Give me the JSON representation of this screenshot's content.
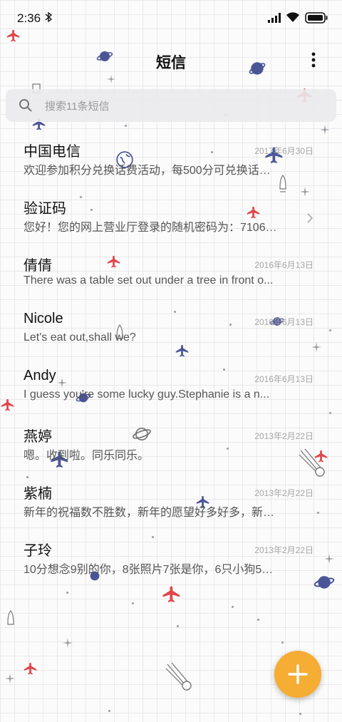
{
  "status_bar": {
    "time": "2:36"
  },
  "header": {
    "title": "短信"
  },
  "search": {
    "placeholder": "搜索11条短信"
  },
  "conversations": [
    {
      "name": "中国电信",
      "date": "2017年6月30日",
      "preview": "欢迎参加积分兑换话费活动，每500分可兑换话费..."
    },
    {
      "name": "验证码",
      "date": "",
      "preview": "您好！您的网上营业厅登录的随机密码为：71067..."
    },
    {
      "name": "倩倩",
      "date": "2016年6月13日",
      "preview": "There was a table set out under a tree in front o..."
    },
    {
      "name": "Nicole",
      "date": "2016年6月13日",
      "preview": "Let's eat out,shall we?"
    },
    {
      "name": "Andy",
      "date": "2016年6月13日",
      "preview": "I guess you're some lucky guy.Stephanie is a n..."
    },
    {
      "name": "燕婷",
      "date": "2013年2月22日",
      "preview": "嗯。收到啦。同乐同乐。"
    },
    {
      "name": "紫楠",
      "date": "2013年2月22日",
      "preview": "新年的祝福数不胜数，新年的愿望好多好多，新年..."
    },
    {
      "name": "子玲",
      "date": "2013年2月22日",
      "preview": "10分想念9别的你，8张照片7张是你，6只小狗5只..."
    }
  ],
  "colors": {
    "accent": "#f5ad34",
    "plane_red": "#e0464a",
    "plane_blue": "#4a5596",
    "planet_blue": "#4a5596"
  },
  "icons": {
    "search": "search-icon",
    "more": "more-vertical-icon",
    "fab": "plus-icon",
    "chevron": "chevron-right-icon"
  }
}
